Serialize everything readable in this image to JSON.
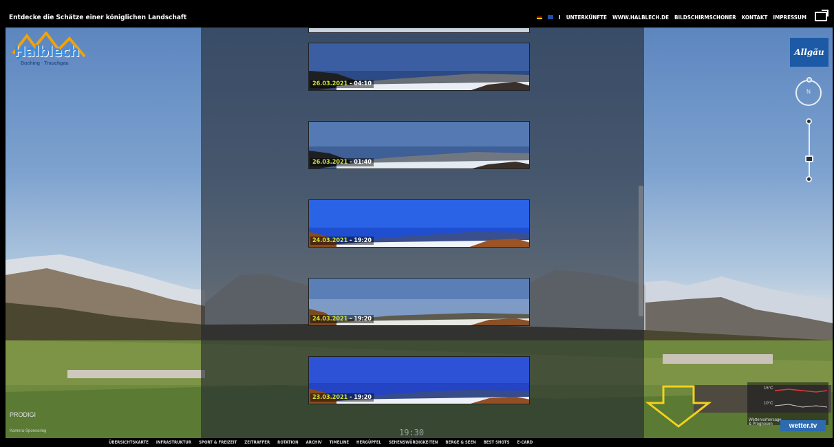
{
  "header": {
    "tagline": "Entdecke die Schätze einer königlichen Landschaft",
    "nav": [
      "UNTERKÜNFTE",
      "WWW.HALBLECH.DE",
      "BILDSCHIRMSCHONER",
      "KONTAKT",
      "IMPRESSUM"
    ],
    "lang_extra": "I"
  },
  "logo": {
    "name": "Halblech",
    "subtitle": "Buching · Trauchgau"
  },
  "partner_logo": "Allgäu",
  "compass_label": "N",
  "archive": {
    "items": [
      {
        "date": "26.03.2021",
        "time": "04:10"
      },
      {
        "date": "26.03.2021",
        "time": "01:40"
      },
      {
        "date": "24.03.2021",
        "time": "19:20"
      },
      {
        "date": "24.03.2021",
        "time": "19:20"
      },
      {
        "date": "23.03.2021",
        "time": "19:20"
      }
    ],
    "current_time": "19:30"
  },
  "provider": {
    "name": "PRODIGI",
    "subtitle": "Kamera-Sponsoring"
  },
  "weather": {
    "badge": "wetter.tv",
    "temp1": "15°C",
    "temp2": "10°C",
    "label": "Wettervorhersage & Prognosen"
  },
  "bottom_nav": [
    "ÜBERSICHTSKARTE",
    "INFRASTRUKTUR",
    "SPORT & FREIZEIT",
    "ZEITRAFFER",
    "ROTATION",
    "ARCHIV",
    "TIMELINE",
    "HERGÜPFEL",
    "SEHENSWÜRDIGKEITEN",
    "BERGE & SEEN",
    "BEST SHOTS",
    "E-CARD"
  ],
  "colors": {
    "date_accent": "#cfe23a",
    "overlay": "#23282f",
    "arrow": "#f2d21b",
    "brand_blue": "#1d5aa5"
  }
}
